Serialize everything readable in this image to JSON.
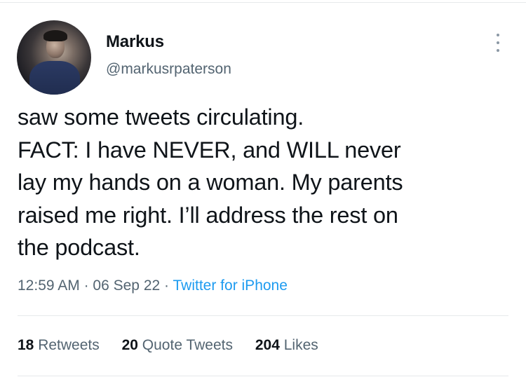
{
  "tweet": {
    "author": {
      "name": "Markus",
      "handle": "@markusrpaterson"
    },
    "text": "saw some tweets circulating.\nFACT: I have NEVER, and WILL never\nlay my hands on a woman. My parents\nraised me right. I’ll address the rest on\nthe podcast.",
    "time": "12:59 AM",
    "date": "06 Sep 22",
    "separator": "·",
    "source": "Twitter for iPhone",
    "stats": {
      "retweets_count": "18",
      "retweets_label": "Retweets",
      "quotes_count": "20",
      "quotes_label": "Quote Tweets",
      "likes_count": "204",
      "likes_label": "Likes"
    }
  },
  "colors": {
    "text": "#0f1419",
    "secondary": "#536471",
    "link": "#1d9bf0",
    "divider": "#e7e9eb"
  },
  "icons": {
    "more": "more-vertical-icon"
  }
}
